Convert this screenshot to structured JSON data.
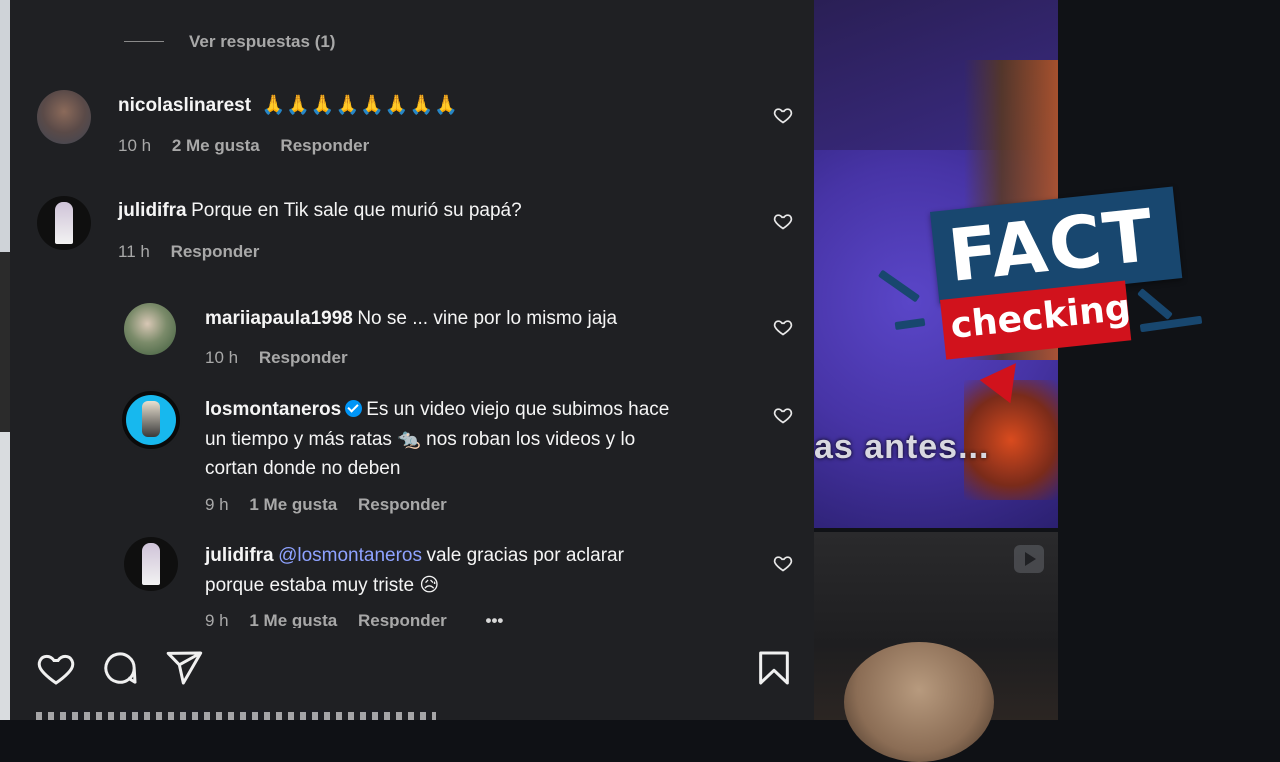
{
  "view_replies": "Ver respuestas (1)",
  "comments": [
    {
      "username": "nicolaslinarest",
      "text": "🙏🙏🙏🙏🙏🙏🙏🙏",
      "time": "10 h",
      "likes": "2 Me gusta",
      "reply": "Responder"
    },
    {
      "username": "julidifra",
      "text": "Porque en Tik sale que murió su papá?",
      "time": "11 h",
      "reply": "Responder"
    },
    {
      "username": "mariiapaula1998",
      "text": "No se ... vine por lo mismo jaja",
      "time": "10 h",
      "reply": "Responder"
    },
    {
      "username": "losmontaneros",
      "text_lines": [
        "Es un video viejo que subimos hace",
        "un tiempo y más ratas 🐀 nos roban los videos y lo",
        "cortan donde no deben"
      ],
      "time": "9 h",
      "likes": "1 Me gusta",
      "reply": "Responder"
    },
    {
      "username": "julidifra",
      "mention": "@losmontaneros",
      "text_lines": [
        "vale gracias por aclarar",
        "porque estaba muy triste 😥"
      ],
      "time": "9 h",
      "likes": "1 Me gusta",
      "reply": "Responder",
      "more": "•••"
    }
  ],
  "video_caption": "as antes...",
  "badge": {
    "fact": "FACT",
    "checking": "checking",
    "blue": "#18476f",
    "red": "#d1121c"
  },
  "icons": [
    "heart-icon",
    "comment-icon",
    "share-icon",
    "bookmark-icon",
    "play-icon",
    "verified-icon"
  ]
}
